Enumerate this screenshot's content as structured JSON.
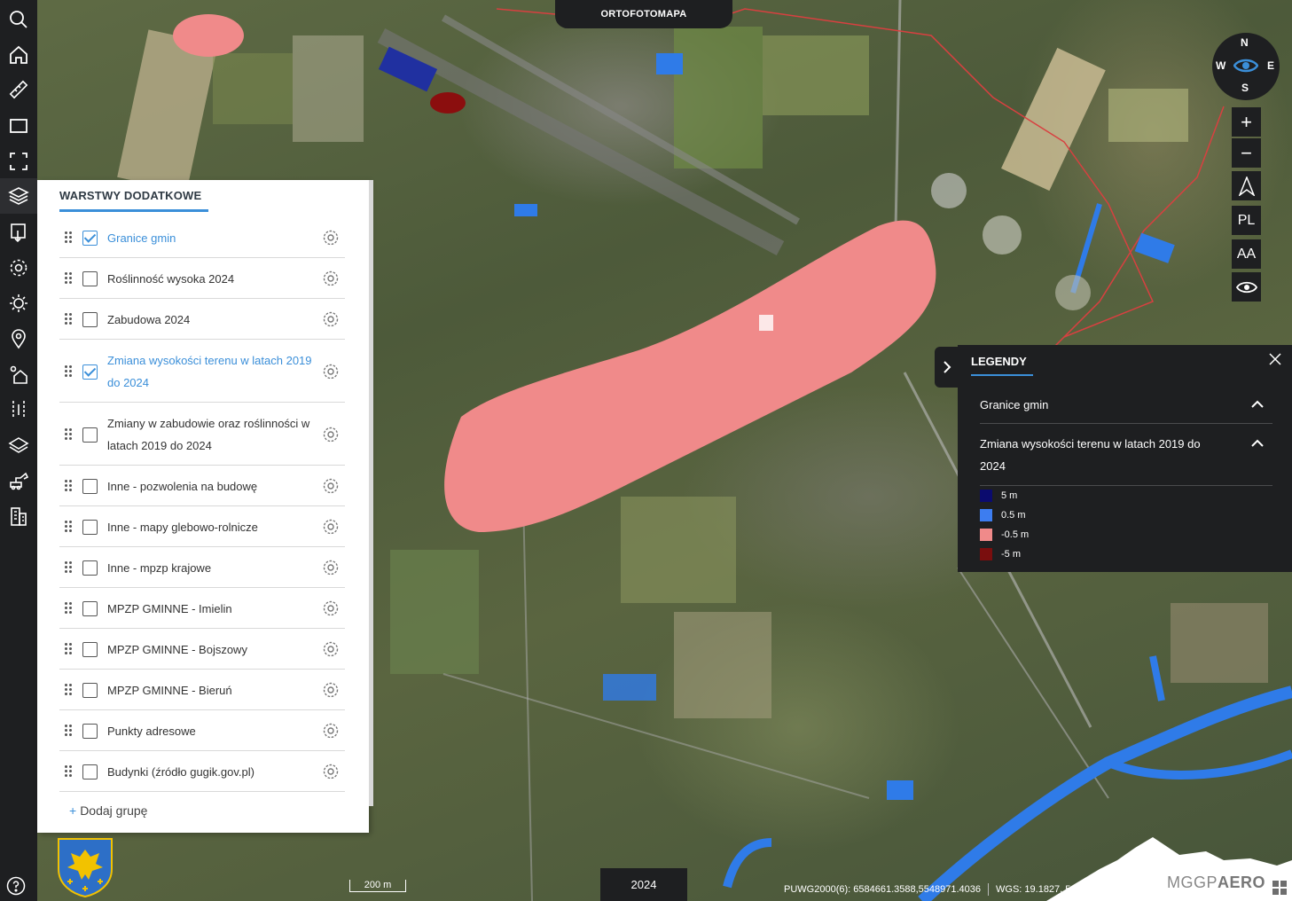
{
  "top_tab": {
    "label": "ORTOFOTOMAPA"
  },
  "layers_panel": {
    "title": "WARSTWY DODATKOWE",
    "layers": [
      {
        "label": "Granice gmin",
        "checked": true
      },
      {
        "label": "Roślinność wysoka 2024",
        "checked": false
      },
      {
        "label": "Zabudowa 2024",
        "checked": false
      },
      {
        "label": "Zmiana wysokości terenu w latach 2019 do 2024",
        "checked": true
      },
      {
        "label": "Zmiany w zabudowie oraz roślinności w latach 2019 do 2024",
        "checked": false
      },
      {
        "label": "Inne - pozwolenia na budowę",
        "checked": false
      },
      {
        "label": "Inne - mapy glebowo-rolnicze",
        "checked": false
      },
      {
        "label": "Inne - mpzp krajowe",
        "checked": false
      },
      {
        "label": "MPZP GMINNE - Imielin",
        "checked": false
      },
      {
        "label": "MPZP GMINNE - Bojszowy",
        "checked": false
      },
      {
        "label": "MPZP GMINNE - Bieruń",
        "checked": false
      },
      {
        "label": "Punkty adresowe",
        "checked": false
      },
      {
        "label": "Budynki (źródło gugik.gov.pl)",
        "checked": false
      }
    ],
    "add_group": {
      "plus": "+",
      "label": "Dodaj grupę"
    }
  },
  "compass": {
    "n": "N",
    "s": "S",
    "e": "E",
    "w": "W"
  },
  "map_controls": {
    "zoom_in": "+",
    "zoom_out": "−",
    "language": "PL",
    "font_size": "AA"
  },
  "legend": {
    "title": "LEGENDY",
    "groups": [
      {
        "label": "Granice gmin"
      },
      {
        "label": "Zmiana wysokości terenu w latach 2019 do 2024"
      }
    ],
    "items": [
      {
        "label": "5 m",
        "color": "#0b0b6e"
      },
      {
        "label": "0.5 m",
        "color": "#3d7df0"
      },
      {
        "label": "-0.5 m",
        "color": "#f08a8a"
      },
      {
        "label": "-5 m",
        "color": "#7a0e0e"
      }
    ]
  },
  "status": {
    "scale": "200 m",
    "year": "2024",
    "puwg": "PUWG2000(6): 6584661.3588,5548971.4036",
    "wgs": "WGS: 19.1827, 50.0709"
  },
  "brand": {
    "prefix": "MGGP",
    "suffix": "AERO"
  },
  "colors": {
    "panel_dark": "#1e1f21",
    "accent": "#3b8fd9",
    "height_loss_overlay": "#f08a8a",
    "height_gain": "#3d7df0"
  }
}
